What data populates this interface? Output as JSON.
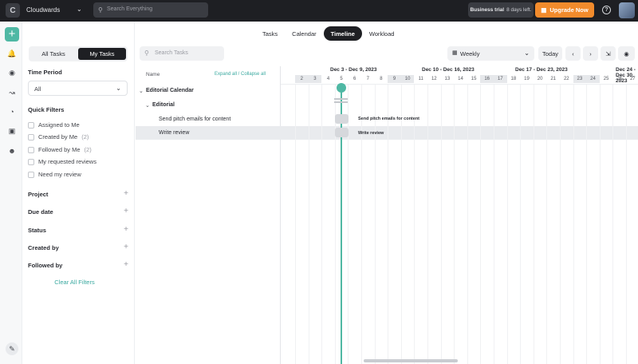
{
  "topbar": {
    "workspace_initial": "C",
    "workspace_name": "Cloudwards",
    "search_placeholder": "Search Everything",
    "trial_label": "Business trial",
    "trial_days": "8 days left.",
    "upgrade_label": "Upgrade Now"
  },
  "rail": {
    "items": [
      "add-icon",
      "bell-icon",
      "globe-icon",
      "chart-icon",
      "pie-icon",
      "folder-icon",
      "people-icon"
    ],
    "bottom_icon": "edit-icon"
  },
  "filters": {
    "segment": {
      "all_tasks": "All Tasks",
      "my_tasks": "My Tasks",
      "active": "my_tasks"
    },
    "time_period_label": "Time Period",
    "time_period_value": "All",
    "quick_filters_label": "Quick Filters",
    "quick_filters": [
      {
        "label": "Assigned to Me",
        "count": ""
      },
      {
        "label": "Created by Me",
        "count": "(2)"
      },
      {
        "label": "Followed by Me",
        "count": "(2)"
      },
      {
        "label": "My requested reviews",
        "count": ""
      },
      {
        "label": "Need my review",
        "count": ""
      }
    ],
    "groups": [
      "Project",
      "Due date",
      "Status",
      "Created by",
      "Followed by"
    ],
    "clear_label": "Clear All Filters"
  },
  "view_tabs": {
    "items": [
      "Tasks",
      "Calendar",
      "Timeline",
      "Workload"
    ],
    "active": "Timeline"
  },
  "toolbar": {
    "search_placeholder": "Search Tasks",
    "scale_value": "Weekly",
    "today_label": "Today",
    "icons": [
      "chevron-left-icon",
      "chevron-right-icon",
      "export-icon",
      "eye-icon"
    ]
  },
  "timeline": {
    "name_header": "Name",
    "expand_label": "Expand all / Collapse all",
    "weeks": [
      "Dec 3 - Dec 9, 2023",
      "Dec 10 - Dec 16, 2023",
      "Dec 17 - Dec 23, 2023",
      "Dec 24 - Dec 30, 2023"
    ],
    "days": [
      "2",
      "3",
      "4",
      "5",
      "6",
      "7",
      "8",
      "9",
      "10",
      "11",
      "12",
      "13",
      "14",
      "15",
      "16",
      "17",
      "18",
      "19",
      "20",
      "21",
      "22",
      "23",
      "24",
      "25",
      "26",
      "27"
    ],
    "weekend_days": [
      "2",
      "3",
      "9",
      "10",
      "16",
      "17",
      "23",
      "24"
    ],
    "today_day": "5",
    "rows": [
      {
        "label": "Editorial Calendar",
        "level": 0,
        "type": "project"
      },
      {
        "label": "Editorial",
        "level": 1,
        "type": "section"
      },
      {
        "label": "Send pitch emails for content",
        "level": 2,
        "type": "task",
        "bar_label": "Send pitch emails for content",
        "bar_day": "5"
      },
      {
        "label": "Write review",
        "level": 2,
        "type": "task",
        "bar_label": "Write review",
        "bar_day": "5",
        "selected": true
      }
    ]
  }
}
